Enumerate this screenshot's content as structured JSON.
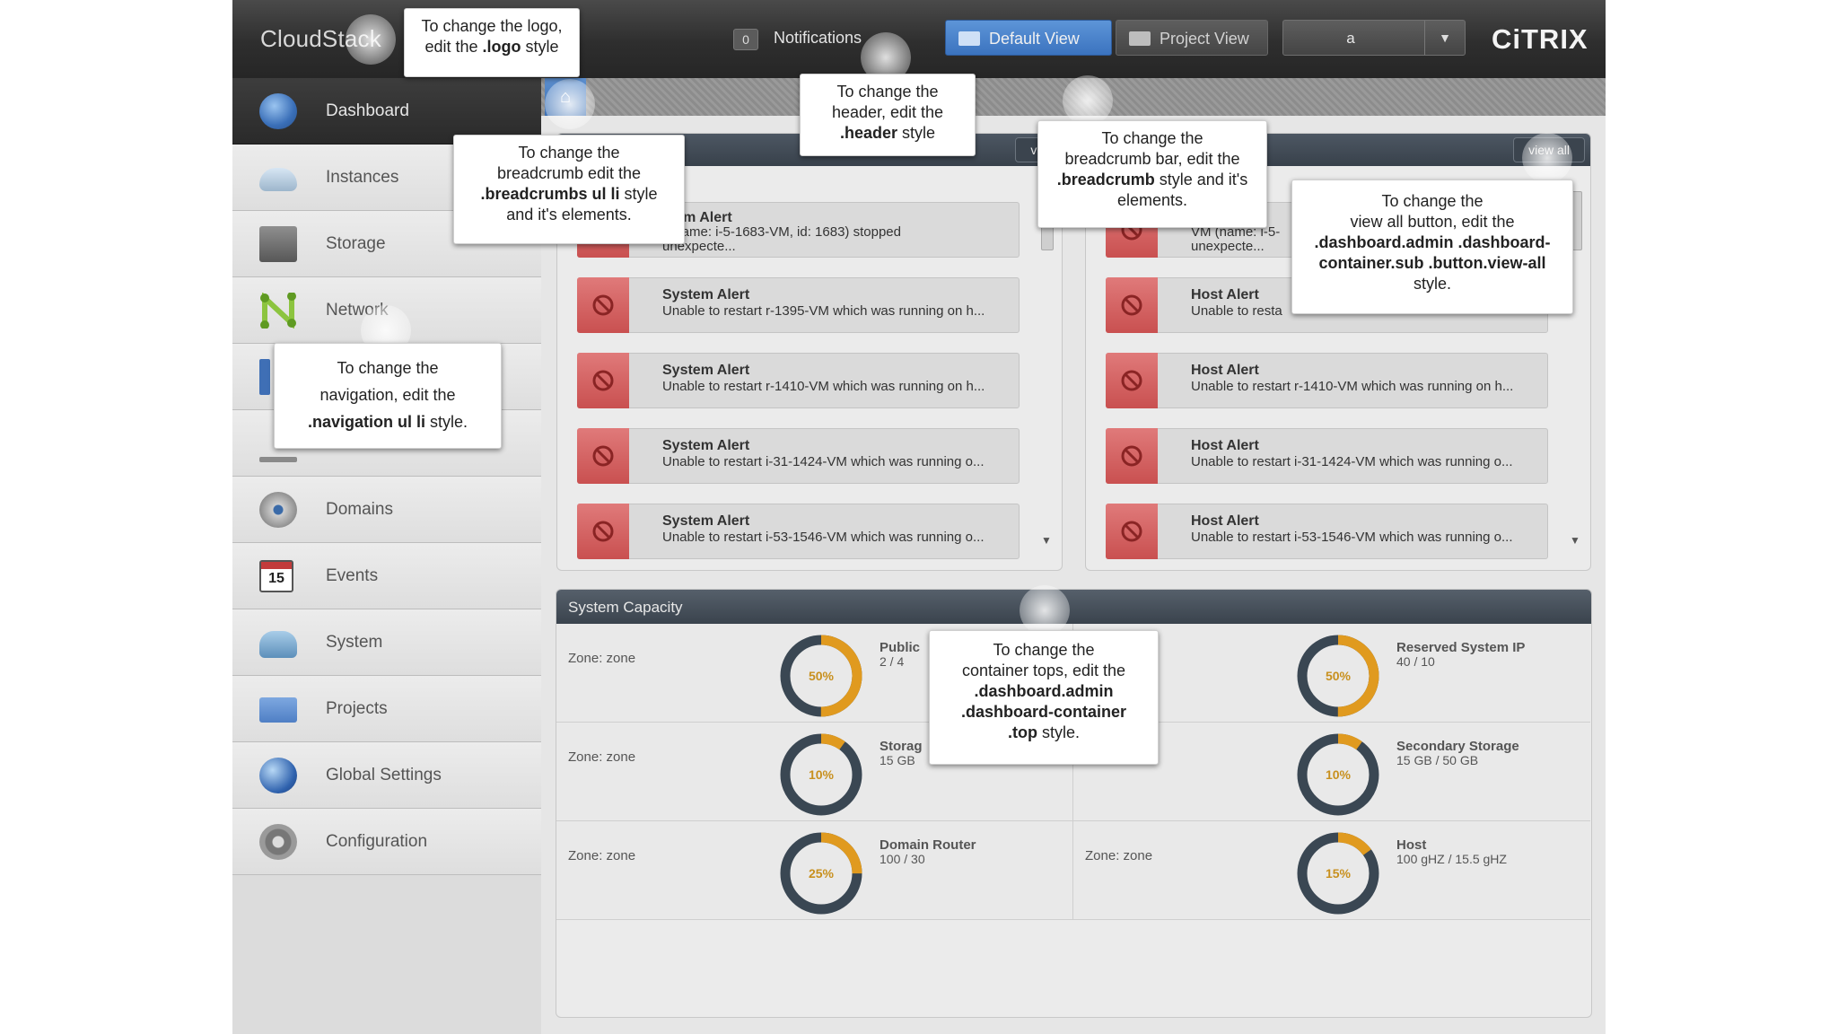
{
  "header": {
    "logo": "CloudStack",
    "notifications_count": "0",
    "notifications_label": "Notifications",
    "default_view": "Default View",
    "project_view": "Project View",
    "user": "a",
    "brand": "CiTRIX"
  },
  "sidebar": {
    "items": [
      {
        "label": "Dashboard",
        "icon": "dashboard-icon",
        "active": true
      },
      {
        "label": "Instances",
        "icon": "cloud-icon"
      },
      {
        "label": "Storage",
        "icon": "storage-icon"
      },
      {
        "label": "Network",
        "icon": "network-icon"
      },
      {
        "label": "",
        "icon": "templates-icon"
      },
      {
        "label": "",
        "icon": "accounts-icon"
      },
      {
        "label": "Domains",
        "icon": "domains-icon"
      },
      {
        "label": "Events",
        "icon": "calendar-icon"
      },
      {
        "label": "System",
        "icon": "system-icon"
      },
      {
        "label": "Projects",
        "icon": "folder-icon"
      },
      {
        "label": "Global Settings",
        "icon": "globe-icon"
      },
      {
        "label": "Configuration",
        "icon": "gear-icon"
      }
    ],
    "events_day": "15"
  },
  "panels": {
    "left": {
      "view_all": "view a",
      "alerts": [
        {
          "title": "stem Alert",
          "desc_line1": "/ (name: i-5-1683-VM, id: 1683) stopped",
          "desc_line2": "unexpecte..."
        },
        {
          "title": "System Alert",
          "desc": "Unable to restart r-1395-VM which was running on h..."
        },
        {
          "title": "System Alert",
          "desc": "Unable to restart r-1410-VM which was running on h..."
        },
        {
          "title": "System Alert",
          "desc": "Unable to restart i-31-1424-VM which was running o..."
        },
        {
          "title": "System Alert",
          "desc": "Unable to restart i-53-1546-VM which was running o..."
        }
      ]
    },
    "right": {
      "view_all": "view all",
      "alerts": [
        {
          "title": "",
          "desc_line1": "VM (name: i-5-",
          "desc_line2": "unexpecte..."
        },
        {
          "title": "Host Alert",
          "desc": "Unable to resta"
        },
        {
          "title": "Host Alert",
          "desc": "Unable to restart r-1410-VM which was running on h..."
        },
        {
          "title": "Host Alert",
          "desc": "Unable to restart i-31-1424-VM which was running o..."
        },
        {
          "title": "Host Alert",
          "desc": "Unable to restart i-53-1546-VM which was running o..."
        }
      ]
    }
  },
  "capacity": {
    "title": "System Capacity",
    "cells": [
      {
        "zone": "Zone: zone",
        "percent": 50,
        "percent_label": "50%",
        "name": "Public",
        "value": "2 / 4"
      },
      {
        "zone": "",
        "percent": 50,
        "percent_label": "50%",
        "name": "Reserved System IP",
        "value": "40 / 10"
      },
      {
        "zone": "Zone: zone",
        "percent": 10,
        "percent_label": "10%",
        "name": "Storag",
        "value": "15 GB"
      },
      {
        "zone": "",
        "percent": 10,
        "percent_label": "10%",
        "name": "Secondary Storage",
        "value": "15 GB / 50 GB"
      },
      {
        "zone": "Zone: zone",
        "percent": 25,
        "percent_label": "25%",
        "name": "Domain Router",
        "value": "100 / 30"
      },
      {
        "zone": "Zone: zone",
        "percent": 15,
        "percent_label": "15%",
        "name": "Host",
        "value": "100 gHZ / 15.5 gHZ"
      }
    ]
  },
  "tooltips": {
    "logo": {
      "l1": "To change the logo,",
      "l2a": "edit the ",
      "l2b": ".logo",
      "l2c": " style"
    },
    "header": {
      "l1": "To change the",
      "l2": "header, edit the",
      "l3": ".header",
      "l3b": " style"
    },
    "breadcrumbs": {
      "l1": "To change the",
      "l2": "breadcrumb edit the",
      "l3": ".breadcrumbs ul li",
      "l3b": " style",
      "l4": "and it's elements."
    },
    "breadcrumb_bar": {
      "l1": "To change the",
      "l2": "breadcrumb bar, edit the",
      "l3": ".breadcrumb",
      "l3b": " style and it's",
      "l4": "elements."
    },
    "view_all": {
      "l1": "To change the",
      "l2": "view all button, edit the",
      "l3": ".dashboard.admin .dashboard-",
      "l4": "container.sub .button.view-all",
      "l5": "style."
    },
    "navigation": {
      "l1": "To change the",
      "l2": "navigation, edit the",
      "l3": ".navigation ul li",
      "l3b": " style."
    },
    "container_tops": {
      "l1": "To change the",
      "l2": "container tops, edit the",
      "l3": ".dashboard.admin",
      "l4": ".dashboard-container",
      "l5": ".top",
      "l5b": " style."
    }
  },
  "colors": {
    "header_bg": "#2e2e2e",
    "accent_blue": "#3b73bf",
    "alert_red": "#c95050",
    "donut_orange": "#e09a1f",
    "donut_track": "#3a4753"
  }
}
